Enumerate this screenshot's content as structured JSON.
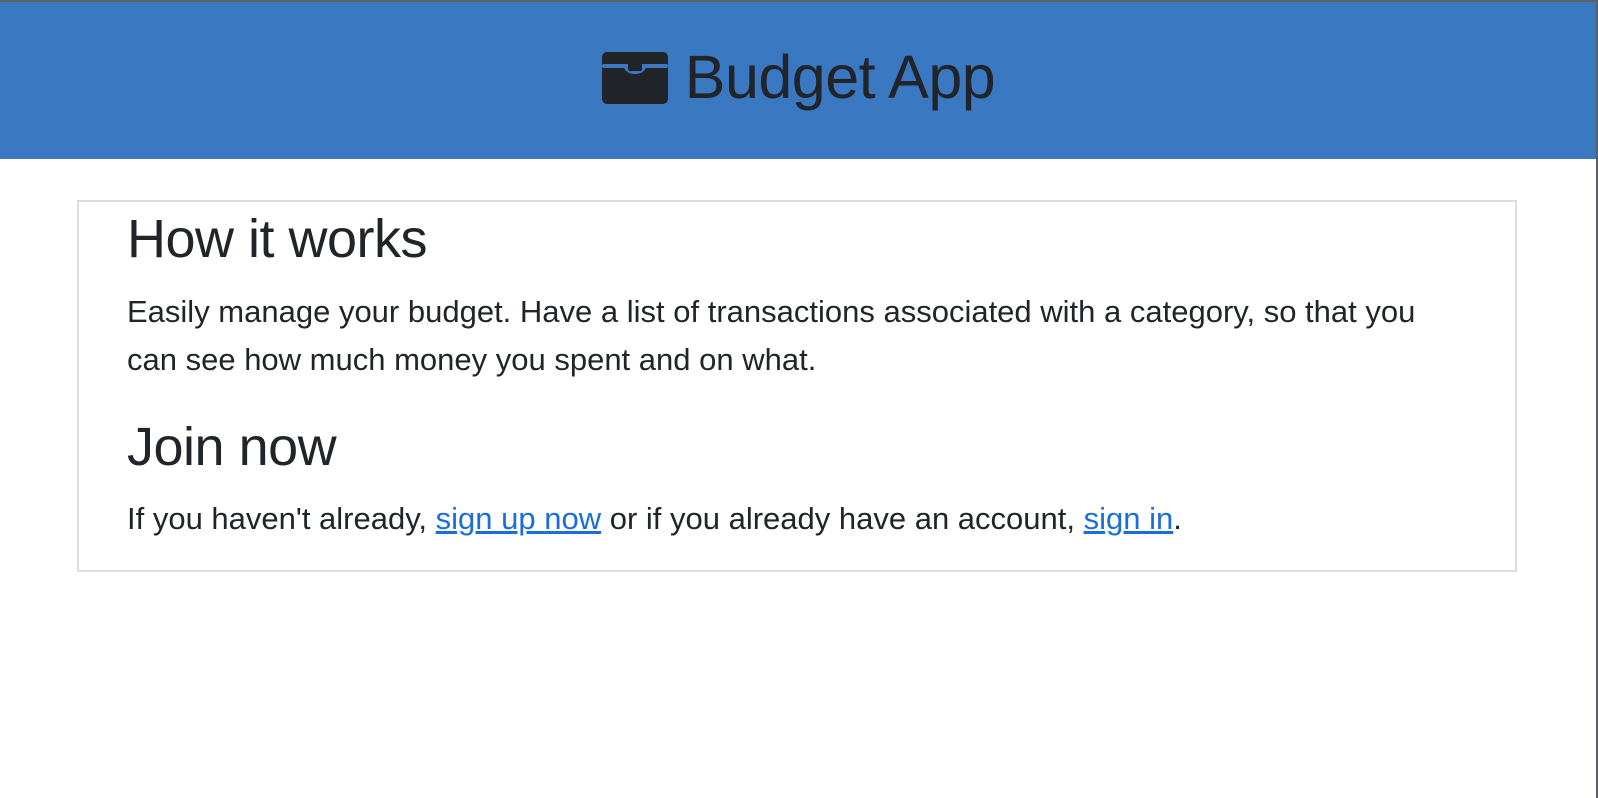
{
  "header": {
    "icon": "briefcase-icon",
    "title": "Budget App",
    "background_color": "#3a78c2"
  },
  "content": {
    "how_it_works": {
      "heading": "How it works",
      "description": "Easily manage your budget. Have a list of transactions associated with a category, so that you can see how much money you spent and on what."
    },
    "join_now": {
      "heading": "Join now",
      "prefix": "If you haven't already, ",
      "signup_link": "sign up now",
      "middle": " or if you already have an account, ",
      "signin_link": "sign in",
      "suffix": "."
    }
  },
  "colors": {
    "link": "#1a6ed8",
    "text": "#212529",
    "card_border": "#dddddd"
  }
}
